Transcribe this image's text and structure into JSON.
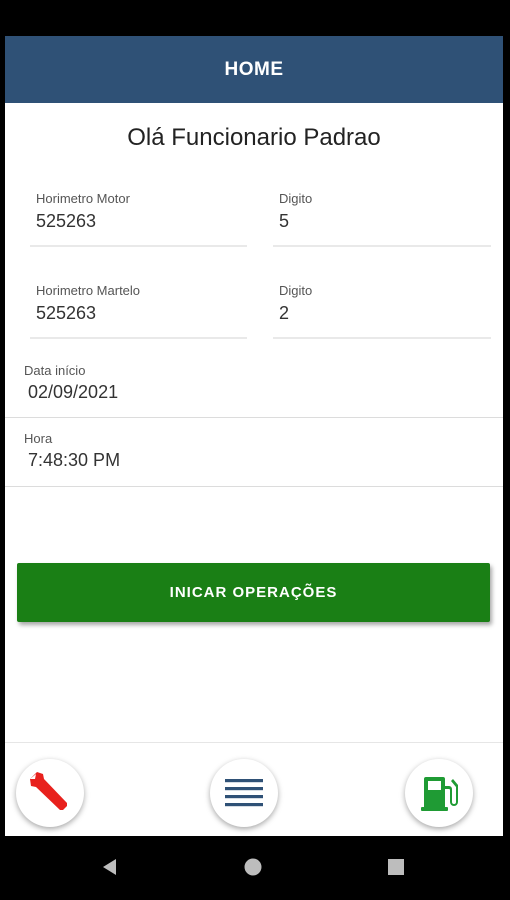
{
  "header": {
    "title": "HOME"
  },
  "greeting": "Olá Funcionario Padrao",
  "fields": {
    "horimetro_motor": {
      "label": "Horimetro Motor",
      "value": "525263"
    },
    "digito_motor": {
      "label": "Digito",
      "value": "5"
    },
    "horimetro_martelo": {
      "label": "Horimetro Martelo",
      "value": "525263"
    },
    "digito_martelo": {
      "label": "Digito",
      "value": "2"
    },
    "data_inicio": {
      "label": "Data início",
      "value": "02/09/2021"
    },
    "hora": {
      "label": "Hora",
      "value": "7:48:30 PM"
    }
  },
  "start_button": {
    "label": "INICAR OPERAÇÕES"
  },
  "bottom_bar": {
    "items": [
      {
        "icon": "wrench-icon",
        "color": "#e8211d"
      },
      {
        "icon": "menu-icon",
        "color": "#2f5176"
      },
      {
        "icon": "fuel-pump-icon",
        "color": "#1f9b34"
      }
    ]
  },
  "colors": {
    "header": "#2f5176",
    "primary_button": "#1a7f15"
  }
}
